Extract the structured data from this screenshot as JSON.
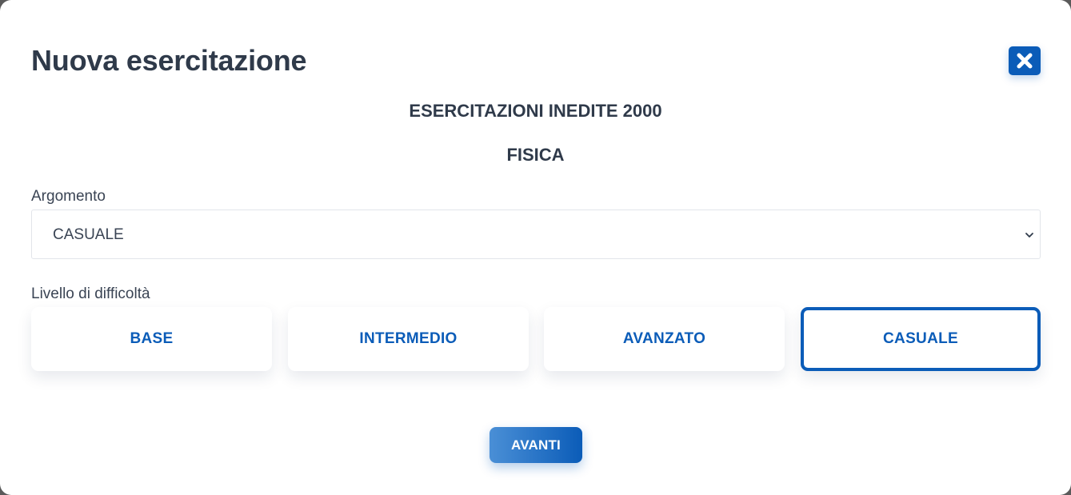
{
  "colors": {
    "accent": "#0b5cb8",
    "text": "#2f3a4a",
    "background": "#ffffff"
  },
  "dialog": {
    "title": "Nuova esercitazione",
    "close_icon": "close-icon"
  },
  "exam": {
    "title": "ESERCITAZIONI INEDITE 2000",
    "subject": "FISICA"
  },
  "topic_field": {
    "label": "Argomento",
    "selected_value": "CASUALE",
    "chevron_icon": "chevron-down-icon"
  },
  "difficulty": {
    "label": "Livello di difficoltà",
    "options": [
      {
        "label": "BASE",
        "selected": false
      },
      {
        "label": "INTERMEDIO",
        "selected": false
      },
      {
        "label": "AVANZATO",
        "selected": false
      },
      {
        "label": "CASUALE",
        "selected": true
      }
    ]
  },
  "actions": {
    "next_label": "AVANTI"
  }
}
